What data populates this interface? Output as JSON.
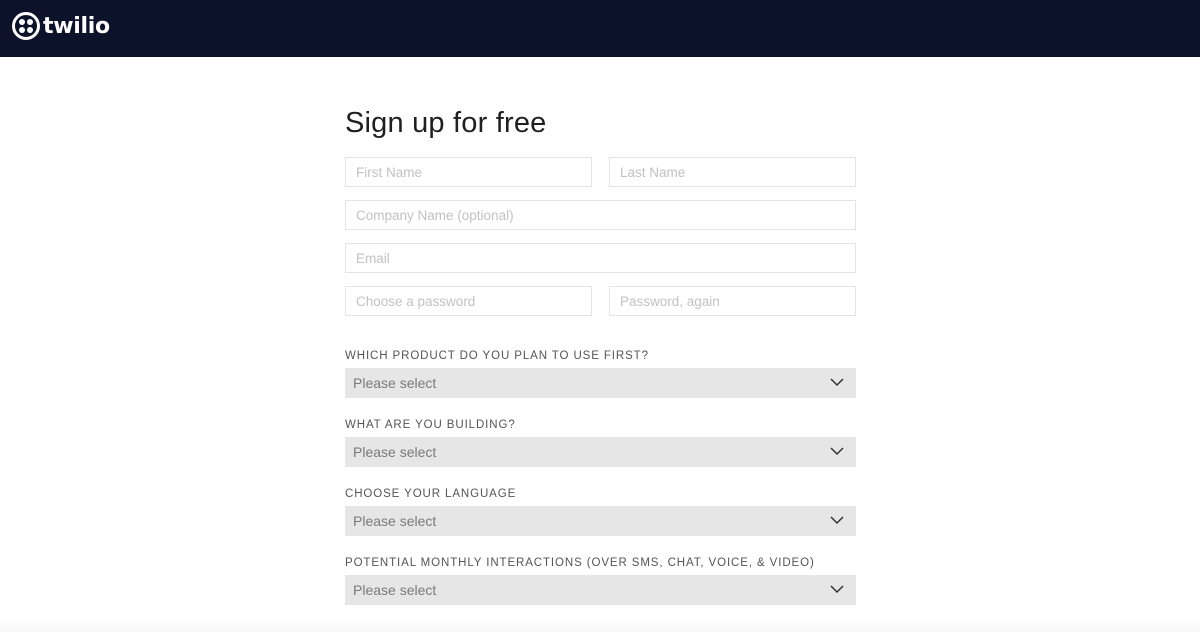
{
  "brand": {
    "name": "twilio",
    "header_bg": "#0d122b"
  },
  "form": {
    "title": "Sign up for free",
    "fields": {
      "first_name": "First Name",
      "last_name": "Last Name",
      "company": "Company Name (optional)",
      "email": "Email",
      "password": "Choose a password",
      "password_again": "Password, again"
    },
    "selects": [
      {
        "label": "WHICH PRODUCT DO YOU PLAN TO USE FIRST?",
        "value": "Please select"
      },
      {
        "label": "WHAT ARE YOU BUILDING?",
        "value": "Please select"
      },
      {
        "label": "CHOOSE YOUR LANGUAGE",
        "value": "Please select"
      },
      {
        "label": "POTENTIAL MONTHLY INTERACTIONS (OVER SMS, CHAT, VOICE, & VIDEO)",
        "value": "Please select"
      }
    ],
    "icons": {
      "select_arrow": "chevron-down-icon"
    }
  }
}
